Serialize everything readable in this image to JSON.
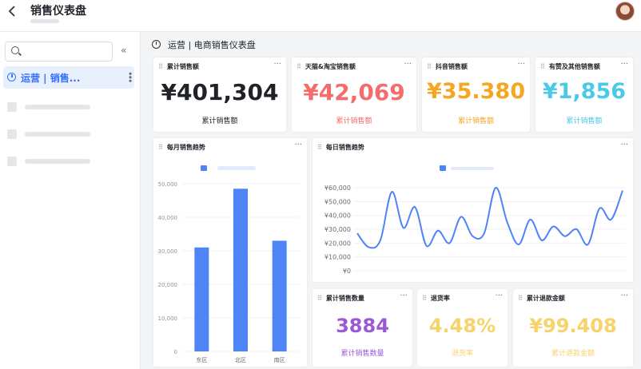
{
  "header": {
    "back_icon": "chevron-left-icon",
    "title": "销售仪表盘",
    "avatar_icon": "user-avatar"
  },
  "sidebar": {
    "search": {
      "placeholder": "",
      "icon": "search-icon"
    },
    "collapse_icon": "double-chevron-left-icon",
    "active_item": {
      "label": "运营 | 销售...",
      "icon": "clock-icon"
    }
  },
  "breadcrumb": {
    "text": "运营 | 电商销售仪表盘",
    "icon": "clock-icon"
  },
  "kpis": [
    {
      "title": "累计销售额",
      "value": "¥401,304",
      "caption": "累计销售额",
      "color": "#1f2329"
    },
    {
      "title": "天猫&淘宝销售额",
      "value": "¥42,069",
      "caption": "累计销售额",
      "color": "#f56c6c"
    },
    {
      "title": "抖音销售额",
      "value": "¥35.380",
      "caption": "累计销售额",
      "color": "#f5a623"
    },
    {
      "title": "有赞及其他销售额",
      "value": "¥1,856",
      "caption": "累计销售额",
      "color": "#4cc9e8"
    }
  ],
  "bottom_kpis": [
    {
      "title": "累计销售数量",
      "value": "3884",
      "caption": "累计销售数量",
      "color": "#9b59d6"
    },
    {
      "title": "退货率",
      "value": "4.48%",
      "caption": "退货率",
      "color": "#f7d36b"
    },
    {
      "title": "累计退款金额",
      "value": "¥99.408",
      "caption": "累计退款金额",
      "color": "#f7d36b"
    }
  ],
  "monthly": {
    "title": "每月销售趋势"
  },
  "daily": {
    "title": "每日销售趋势"
  },
  "chart_data": [
    {
      "type": "bar",
      "categories": [
        "东区",
        "北区",
        "南区"
      ],
      "values": [
        31000,
        48500,
        33000
      ],
      "ylim": [
        0,
        50000
      ],
      "yticks": [
        "0",
        "10,000",
        "20,000",
        "30,000",
        "40,000",
        "50,000"
      ],
      "color": "#4f84f7"
    },
    {
      "type": "line",
      "values": [
        27000,
        17000,
        22000,
        57000,
        31000,
        46000,
        18000,
        29000,
        20000,
        39000,
        25000,
        27000,
        60000,
        35000,
        19000,
        37000,
        22000,
        32000,
        25000,
        30000,
        19000,
        45000,
        37000,
        58000
      ],
      "ylim": [
        0,
        60000
      ],
      "yticks": [
        "¥0",
        "¥10,000",
        "¥20,000",
        "¥30,000",
        "¥40,000",
        "¥50,000",
        "¥60,000"
      ],
      "color": "#4f84f7"
    }
  ]
}
